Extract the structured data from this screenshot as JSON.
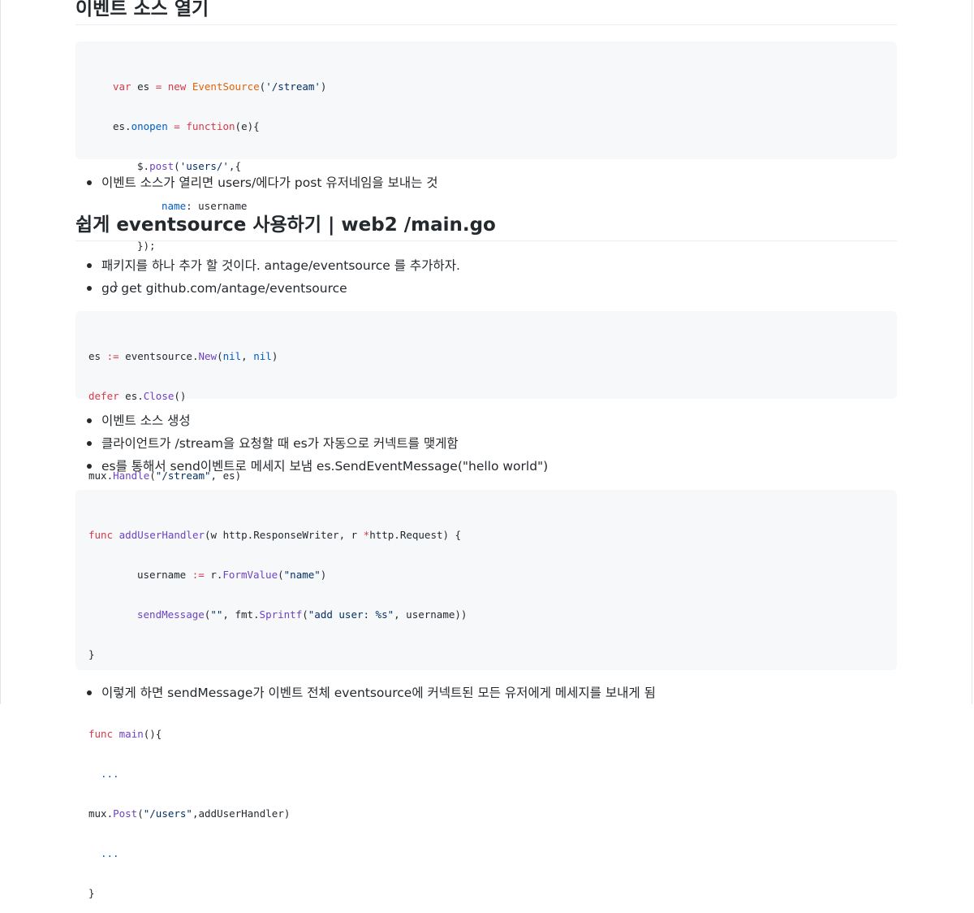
{
  "headings": {
    "h1": "이벤트 소스 열기",
    "h2": "쉽게 eventsource 사용하기 | web2 /main.go"
  },
  "code1": {
    "l1a": "var",
    "l1b": " es ",
    "l1c": "=",
    "l1d": " ",
    "l1e": "new",
    "l1f": " ",
    "l1g": "EventSource",
    "l1h": "(",
    "l1i": "'/stream'",
    "l1j": ")",
    "l2a": "es.",
    "l2b": "onopen",
    "l2c": " ",
    "l2d": "=",
    "l2e": " ",
    "l2f": "function",
    "l2g": "(e){",
    "l3a": "$.",
    "l3b": "post",
    "l3c": "(",
    "l3d": "'users/'",
    "l3e": ",{",
    "l4a": "name",
    "l4b": ": username",
    "l5": "});",
    "l6": "}"
  },
  "bullets1": [
    "이벤트 소스가 열리면 users/에다가 post 유저네임을 보내는 것"
  ],
  "bullets2": [
    "패키지를 하나 추가 할 것이다. antage/eventsource 를 추가하자.",
    "go get github.com/antage/eventsource"
  ],
  "code2": {
    "l1a": "es ",
    "l1b": ":=",
    "l1c": " eventsource.",
    "l1d": "New",
    "l1e": "(",
    "l1f": "nil",
    "l1g": ", ",
    "l1h": "nil",
    "l1i": ")",
    "l2a": "defer",
    "l2b": " es.",
    "l2c": "Close",
    "l2d": "()",
    "l4a": "mux.",
    "l4b": "Handle",
    "l4c": "(",
    "l4d": "\"/stream\"",
    "l4e": ", es)"
  },
  "bullets3": [
    "이벤트 소스 생성",
    "클라이언트가 /stream을 요청할 때 es가 자동으로 커넥트를 맺게함",
    "es를 통해서 send이벤트로 메세지 보냄 es.SendEventMessage(\"hello world\")"
  ],
  "code3": {
    "l1a": "func",
    "l1b": " ",
    "l1c": "addUserHandler",
    "l1d": "(w http.ResponseWriter, r ",
    "l1e": "*",
    "l1f": "http.Request) {",
    "l2a": "username ",
    "l2b": ":=",
    "l2c": " r.",
    "l2d": "FormValue",
    "l2e": "(",
    "l2f": "\"name\"",
    "l2g": ")",
    "l3a": "sendMessage",
    "l3b": "(",
    "l3c": "\"\"",
    "l3d": ", fmt.",
    "l3e": "Sprintf",
    "l3f": "(",
    "l3g": "\"add user: %s\"",
    "l3h": ", username))",
    "l4": "}",
    "l6a": "func",
    "l6b": " ",
    "l6c": "main",
    "l6d": "(){",
    "l7": "...",
    "l8a": "mux.",
    "l8b": "Post",
    "l8c": "(",
    "l8d": "\"/users\"",
    "l8e": ",addUserHandler)",
    "l9": "...",
    "l10": "}"
  },
  "bullets4": [
    "이렇게 하면 sendMessage가 이벤트 전체 eventsource에 커넥트된 모든 유저에게 메세지를 보내게 됨"
  ]
}
